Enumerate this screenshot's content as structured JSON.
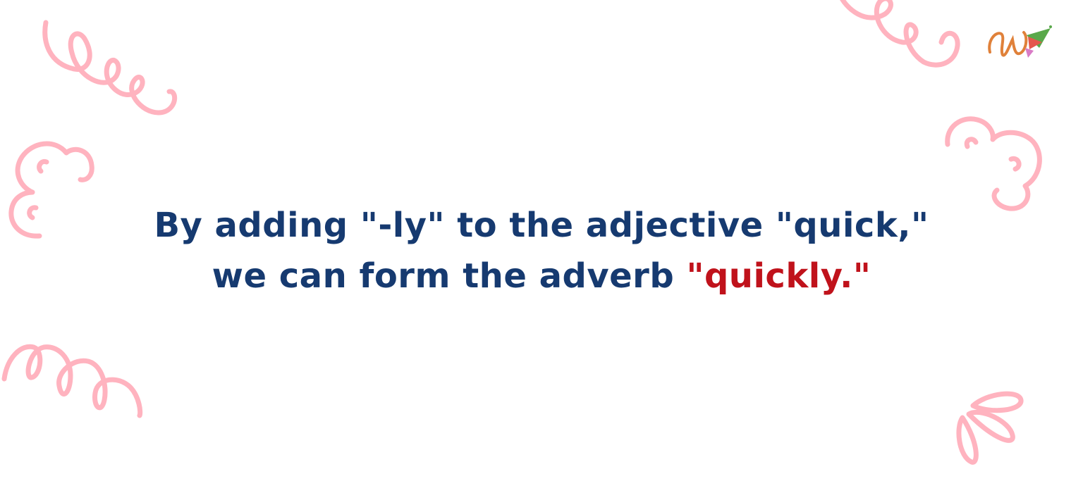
{
  "sentence": {
    "line1": "By adding \"-ly\" to the adjective \"quick,\"",
    "line2_lead": "we can form the adverb",
    "line2_highlight": "\"quickly.\""
  },
  "colors": {
    "text": "#163a70",
    "highlight": "#c0121b",
    "doodle": "#ffb3bf",
    "logo_orange": "#e0813a",
    "logo_green": "#59a84a",
    "logo_pink": "#d97bc6",
    "logo_red": "#e4574d"
  },
  "icons": {
    "logo": "brand-logo",
    "decorations": [
      "loop-squiggle",
      "cloud-swirl",
      "bloop-squiggle",
      "petal-burst"
    ]
  }
}
